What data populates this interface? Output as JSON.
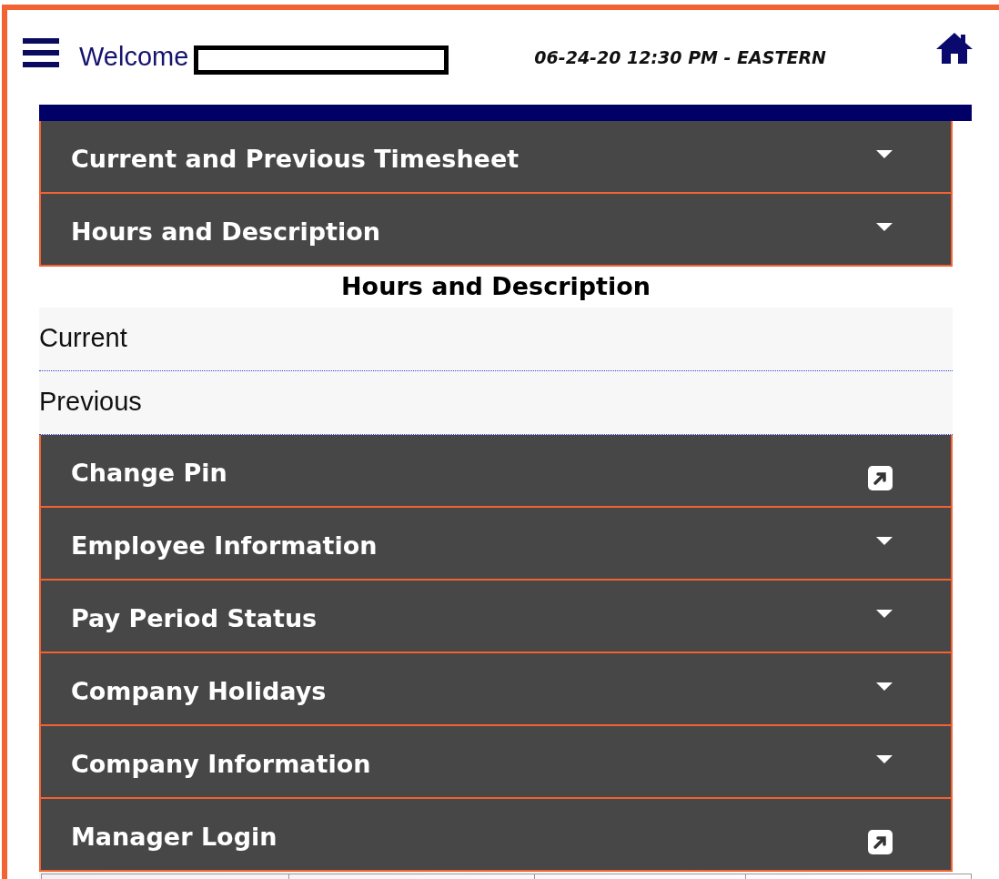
{
  "header": {
    "welcome": "Welcome",
    "datetime": "06-24-20 12:30 PM - EASTERN"
  },
  "menu": [
    {
      "kind": "accordion",
      "label": "Current and Previous Timesheet"
    },
    {
      "kind": "accordion",
      "label": "Hours and Description",
      "panel": {
        "heading": "Hours and Description",
        "links": [
          "Current",
          "Previous"
        ]
      }
    },
    {
      "kind": "link",
      "label": "Change Pin"
    },
    {
      "kind": "accordion",
      "label": "Employee Information"
    },
    {
      "kind": "accordion",
      "label": "Pay Period Status"
    },
    {
      "kind": "accordion",
      "label": "Company Holidays"
    },
    {
      "kind": "accordion",
      "label": "Company Information"
    },
    {
      "kind": "link",
      "label": "Manager Login"
    }
  ]
}
